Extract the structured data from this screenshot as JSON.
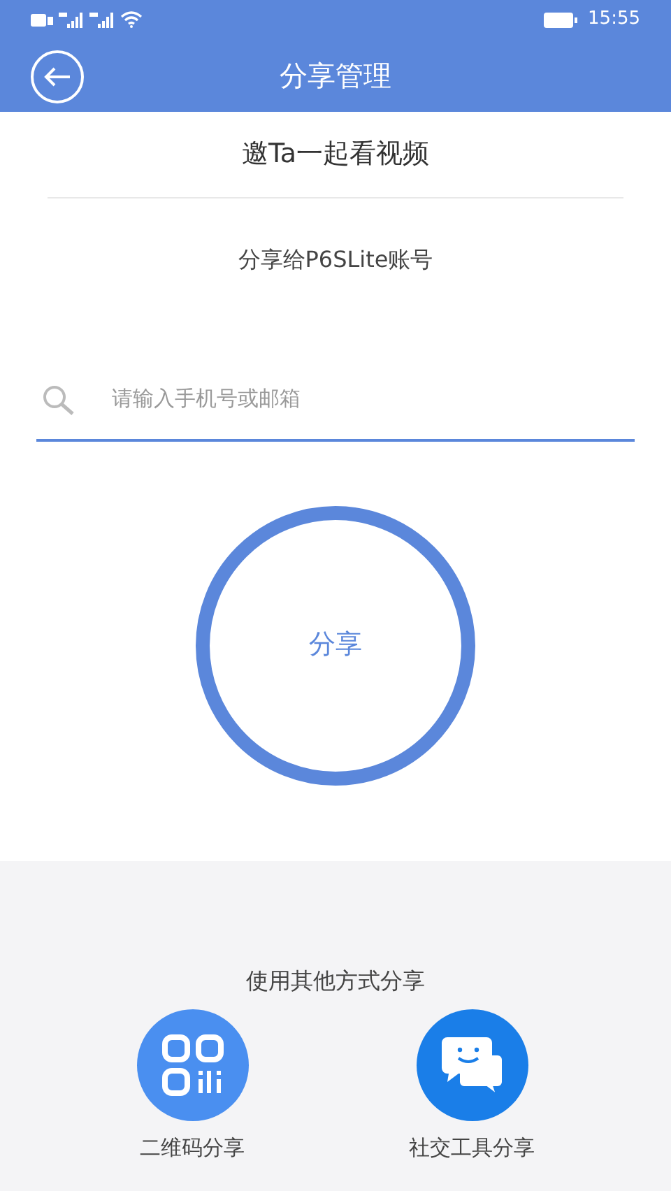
{
  "status_bar": {
    "time": "15:55"
  },
  "header": {
    "title": "分享管理"
  },
  "invite_title": "邀Ta一起看视频",
  "share_to": "分享给P6SLite账号",
  "search": {
    "placeholder": "请输入手机号或邮箱"
  },
  "share_button": "分享",
  "other_methods": {
    "title": "使用其他方式分享",
    "options": [
      {
        "label": "二维码分享",
        "kind": "qr"
      },
      {
        "label": "社交工具分享",
        "kind": "chat"
      }
    ]
  }
}
